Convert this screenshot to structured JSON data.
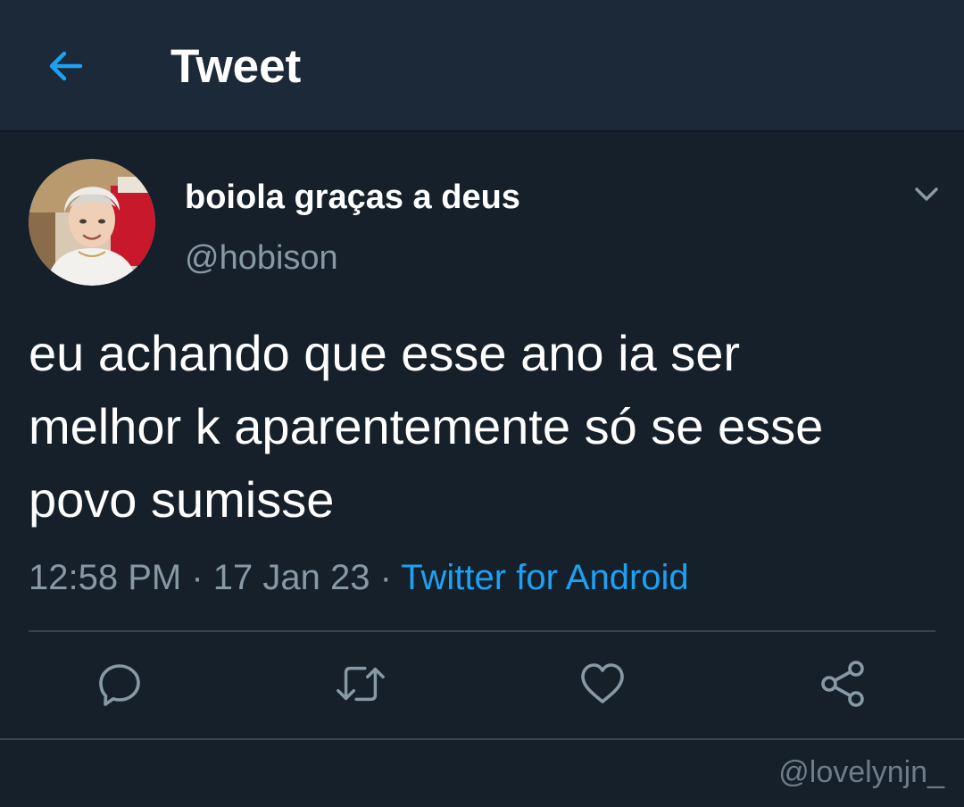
{
  "header": {
    "back_icon": "arrow-left-icon",
    "title": "Tweet",
    "accent_color": "#1da1f2"
  },
  "tweet": {
    "avatar_icon": "user-avatar",
    "display_name": "boiola graças a deus",
    "handle": "@hobison",
    "menu_icon": "chevron-down-icon",
    "text": "eu achando que esse ano ia ser\nmelhor k aparentemente só se esse\npovo sumisse",
    "time": "12:58 PM",
    "separator": " · ",
    "date": "17 Jan 23",
    "source": "Twitter for Android"
  },
  "actions": [
    {
      "icon": "reply-icon"
    },
    {
      "icon": "retweet-icon"
    },
    {
      "icon": "like-icon"
    },
    {
      "icon": "share-icon"
    }
  ],
  "watermark": "@lovelynjn_",
  "colors": {
    "background": "#15202b",
    "header_background": "#1c2938",
    "secondary_text": "#8899a6",
    "link": "#1da1f2",
    "divider": "#38444d"
  }
}
